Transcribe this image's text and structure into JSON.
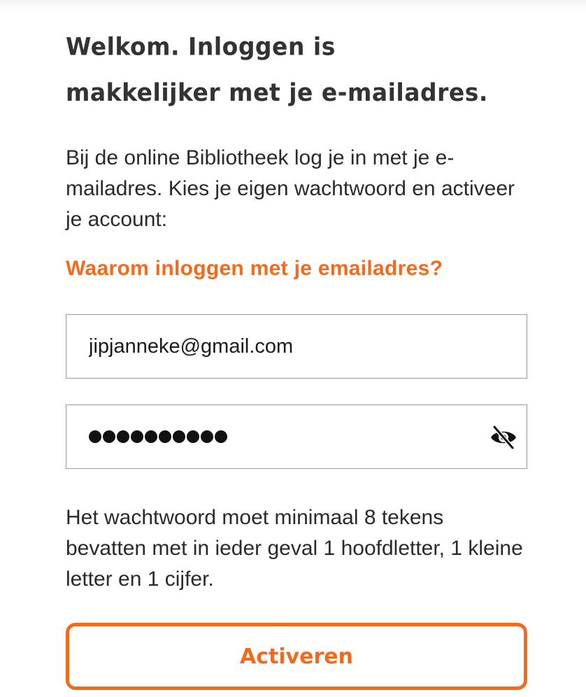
{
  "heading": {
    "line1": "Welkom. Inloggen is",
    "line2": "makkelijker met je e-mailadres."
  },
  "intro_text": "Bij de online Bibliotheek log je in met je e-mailadres. Kies je eigen wachtwoord en activeer je account:",
  "why_link_label": "Waarom inloggen met je emailadres?",
  "email_field": {
    "value": "jipjanneke@gmail.com"
  },
  "password_field": {
    "masked_length": 10,
    "toggle_icon": "eye-slash-icon"
  },
  "password_hint": "Het wachtwoord moet minimaal 8 tekens bevatten met in ieder geval 1 hoofdletter, 1 kleine letter en 1 cijfer.",
  "activate_button_label": "Activeren",
  "colors": {
    "accent": "#f26b1d",
    "text": "#2b2b2b",
    "field_border": "#9a9a9a"
  }
}
